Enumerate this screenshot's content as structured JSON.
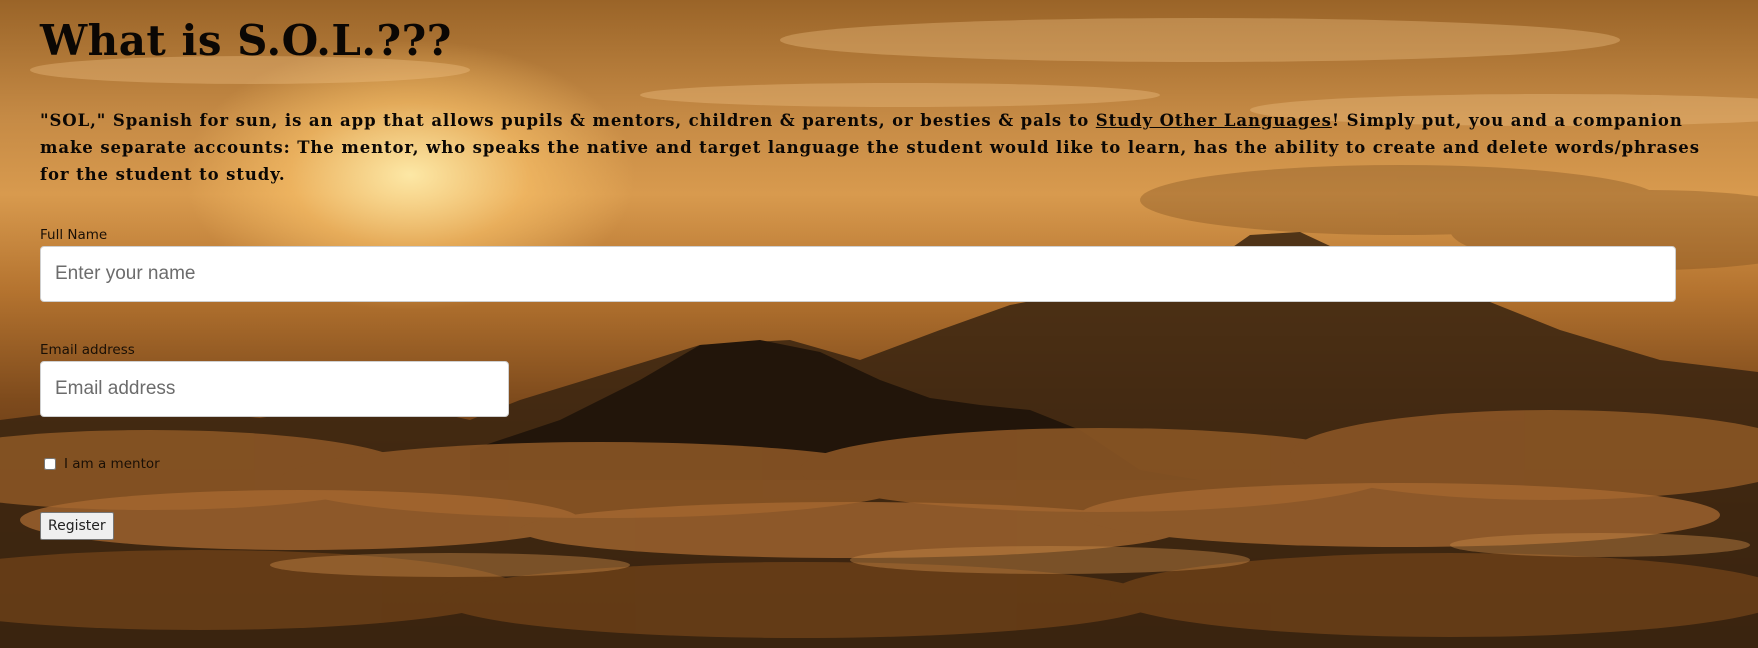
{
  "page": {
    "heading": "What is S.O.L.???",
    "description_before_link": "\"SOL,\" Spanish for sun, is an app that allows pupils & mentors, children & parents, or besties & pals to ",
    "description_link": "Study Other Languages",
    "description_after_link": "! Simply put, you and a companion make separate accounts: The mentor, who speaks the native and target language the student would like to learn, has the ability to create and delete words/phrases for the student to study."
  },
  "form": {
    "name_label": "Full Name",
    "name_placeholder": "Enter your name",
    "name_value": "",
    "email_label": "Email address",
    "email_placeholder": "Email address",
    "email_value": "",
    "mentor_checkbox_label": "I am a mentor",
    "mentor_checked": false,
    "register_label": "Register"
  },
  "background": {
    "scene": "sunset-over-mountains-and-clouds",
    "colors": {
      "sky_light": "#d89a4e",
      "sky_dark": "#9a6428",
      "mountain": "#2a1a0e",
      "clouds": "#7a4a1e"
    }
  }
}
